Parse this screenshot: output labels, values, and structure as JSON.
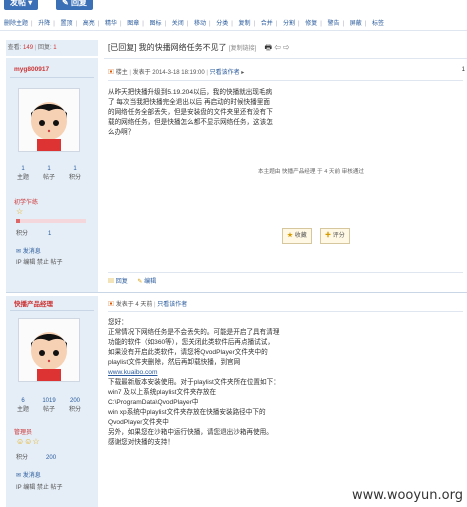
{
  "topbar": {
    "post_label": "发帖",
    "reply_label": "回复"
  },
  "modbar": [
    "删除主题",
    "升降",
    "置顶",
    "高亮",
    "精华",
    "图章",
    "图标",
    "关闭",
    "移动",
    "分类",
    "复制",
    "合并",
    "分割",
    "修复",
    "警告",
    "屏蔽",
    "标签"
  ],
  "stats": {
    "view_label": "查看:",
    "views": "149",
    "reply_label": "回复:",
    "replies": "1"
  },
  "title": {
    "text": "[已回复] 我的快播网络任务不见了",
    "tag": "[复制链接]"
  },
  "posts": [
    {
      "author": "myg800917",
      "stats": [
        {
          "num": "1",
          "label": "主题"
        },
        {
          "num": "1",
          "label": "帖子"
        },
        {
          "num": "1",
          "label": "积分"
        }
      ],
      "group": "初学乍练",
      "score_label": "积分",
      "score": "1",
      "send_msg": "发消息",
      "ip_ops": "IP  编辑  禁止  帖子",
      "meta_author": "楼主",
      "meta_date": "发表于 2014-3-18 18:19:00",
      "meta_only": "只看该作者",
      "floor": "1",
      "content": "从昨天把快播升级到5.19.204以后，我的快播就出现毛病了  每次当我把快播完全退出以后 再启动的时候快播里面的网络任务全部丢失，但是安装盘的文件夹里还有没有下载的网络任务，但是快播怎么都不显示网络任务，这该怎么办啊？",
      "edited": "本主题由 快播产品经理 于 4 天前 审核通过",
      "collect": "收藏",
      "rate": "评分",
      "reply": "回复",
      "edit": "编辑"
    },
    {
      "author": "快播产品经理",
      "stats": [
        {
          "num": "6",
          "label": "主题"
        },
        {
          "num": "1019",
          "label": "帖子"
        },
        {
          "num": "200",
          "label": "积分"
        }
      ],
      "group": "管理员",
      "score_label": "积分",
      "score": "200",
      "send_msg": "发消息",
      "ip_ops": "IP  编辑  禁止  帖子",
      "meta_date": "发表于 4 天前",
      "meta_only": "只看该作者",
      "content_lines": [
        "您好：",
        "    正常情况下网络任务是不会丢失的。可能是开启了具有清理功能的软件（如360等），您关闭此类软件后再点播试试，如果没有开启此类软件，请您将QvodPlayer文件夹中的playlist文件夹删除，然后再卸载快播，到官网",
        "www.kuaibo.com",
        "下载最新版本安装使用。对于playlist文件夹所在位置如下：",
        "    win7 及以上系统playlist文件夹存放在C:\\ProgramData\\QvodPlayer中",
        "    win  xp系统中playlist文件夹存放在快播安装路径中下的QvodPlayer文件夹中",
        "    另外，如果您在沙箱中运行快播，请您退出沙箱再使用。",
        "    感谢您对快播的支持！"
      ]
    }
  ],
  "watermark": "www.wooyun.org"
}
